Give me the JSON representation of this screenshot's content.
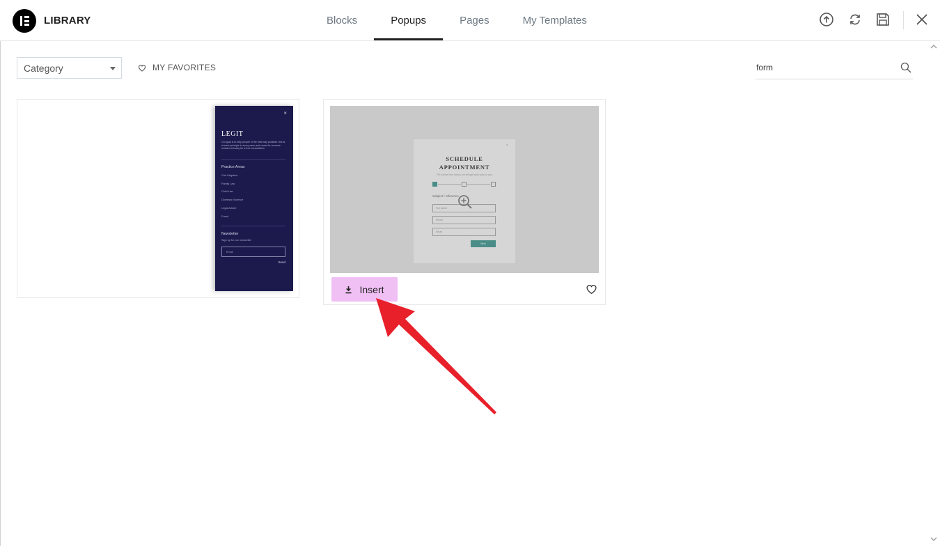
{
  "header": {
    "title": "LIBRARY",
    "tabs": [
      {
        "label": "Blocks",
        "active": false
      },
      {
        "label": "Popups",
        "active": true
      },
      {
        "label": "Pages",
        "active": false
      },
      {
        "label": "My Templates",
        "active": false
      }
    ],
    "icons": [
      "upload-icon",
      "sync-icon",
      "save-icon",
      "close-icon"
    ]
  },
  "toolbar": {
    "category_label": "Category",
    "favorites_label": "MY FAVORITES",
    "search_value": "form"
  },
  "templates": [
    {
      "name": "Legit",
      "thumbnail": {
        "close": "×",
        "brand": "LEGIT",
        "blurb": "Our goal is to help people in the best way possible. this is a basic principle in every case and cause for success. contact us today for a free consultation",
        "section_practice": "Practice Areas",
        "items": [
          "Civil Litigation",
          "Family Law",
          "Child Law",
          "Domestic Violence",
          "Legal Advice",
          "Fraud"
        ],
        "section_newsletter": "Newsletter",
        "newsletter_sub": "Sign up for our newsletter",
        "email_placeholder": "Email",
        "send": "Send"
      }
    },
    {
      "name": "Schedule Appointment",
      "thumbnail": {
        "close": "×",
        "title_line1": "SCHEDULE",
        "title_line2": "APPOINTMENT",
        "subtitle": "Fill out the form below, we will get back soon to you",
        "label": "Subject / reference",
        "fields": [
          "Full Name",
          "Phone",
          "Email"
        ],
        "next": "Next"
      },
      "insert_label": "Insert"
    }
  ],
  "colors": {
    "insert_bg": "#f0c0f5",
    "legit_bg": "#1c1a4d",
    "accent_teal": "#4a8d88",
    "arrow": "#e8202a"
  }
}
